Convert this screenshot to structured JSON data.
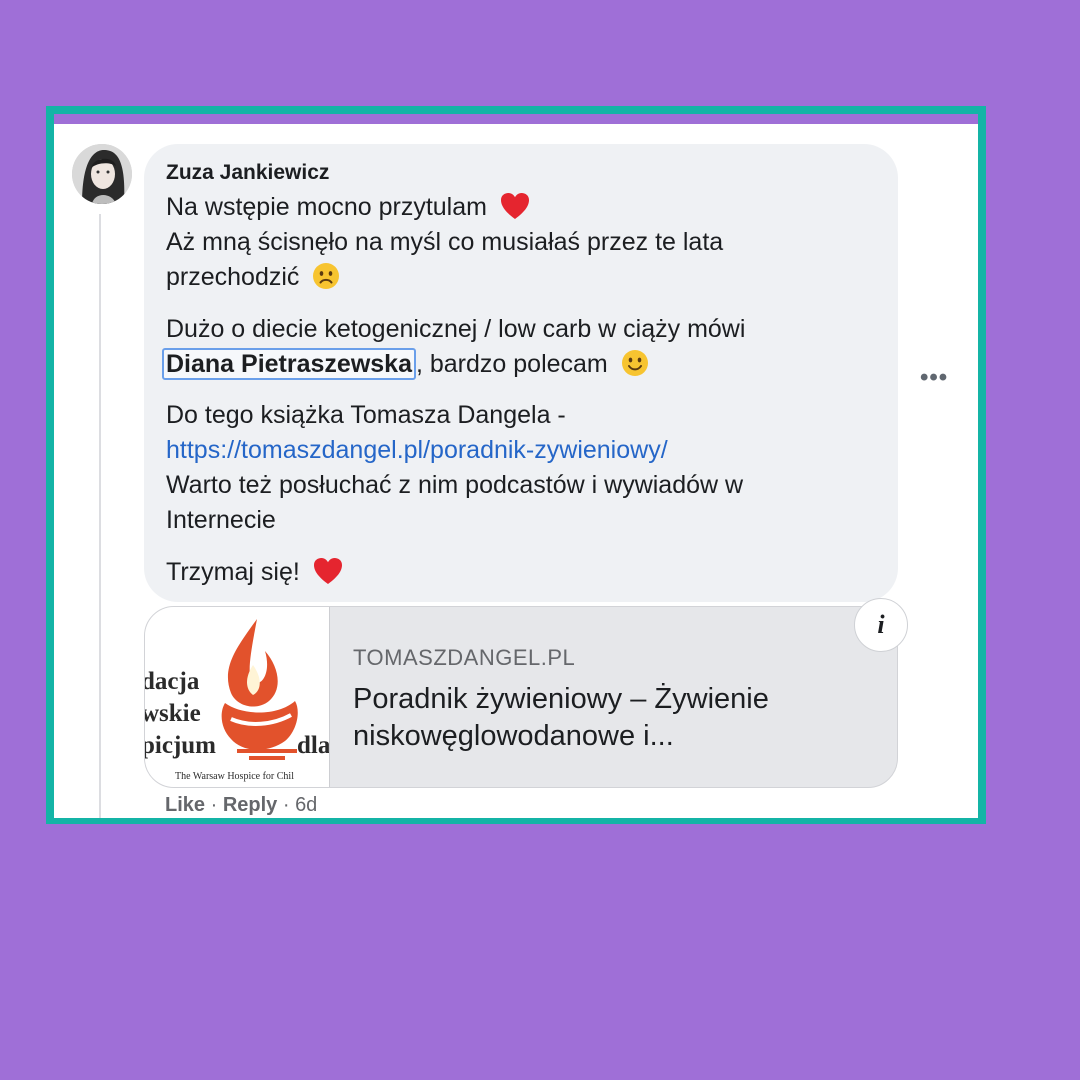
{
  "comment": {
    "author": "Zuza Jankiewicz",
    "para1": {
      "line1": "Na wstępie mocno przytulam",
      "line2": "Aż mną ścisnęło na myśl co musiałaś przez te lata",
      "line3": "przechodzić"
    },
    "para2": {
      "line1": "Dużo o diecie ketogenicznej / low carb w ciąży mówi",
      "mention": "Diana Pietraszewska",
      "after_mention": ", bardzo polecam"
    },
    "para3": {
      "line1": "Do tego książka Tomasza Dangela -",
      "link": "https://tomaszdangel.pl/poradnik-zywieniowy/",
      "line3": "Warto też posłuchać z nim podcastów i wywiadów w",
      "line4": "Internecie"
    },
    "para4": {
      "line1": "Trzymaj się!"
    },
    "more_icon": "more-horizontal-icon",
    "more_label": "•••"
  },
  "link_preview": {
    "domain": "TOMASZDANGEL.PL",
    "title": "Poradnik żywieniowy – Żywienie niskowęglowodanowe i...",
    "thumbnail_text": {
      "line1": "dacja",
      "line2": "wskie",
      "line3": "picjum",
      "line3_right": "dla",
      "caption": "The Warsaw Hospice for Chil"
    },
    "info_label": "i"
  },
  "actions": {
    "like": "Like",
    "separator": " · ",
    "reply": "Reply",
    "time": "6d"
  },
  "colors": {
    "background": "#9f6fd7",
    "frame": "#14b4a6",
    "link": "#2566c8",
    "bubble": "#eff1f4",
    "heart": "#e5252f",
    "flame": "#e2522c"
  }
}
